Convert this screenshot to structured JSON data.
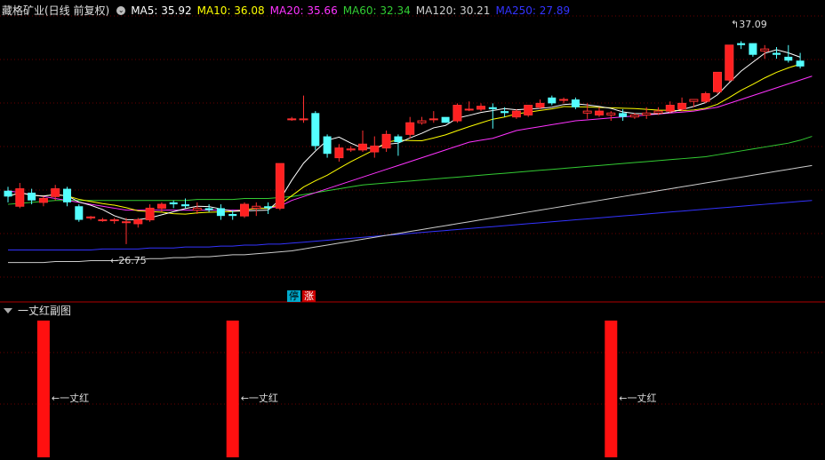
{
  "main_panel": {
    "title": "藏格矿业(日线 前复权)",
    "ma": [
      {
        "label": "MA5: 35.92",
        "color": "#ffffff"
      },
      {
        "label": "MA10: 36.08",
        "color": "#ffff00"
      },
      {
        "label": "MA20: 35.66",
        "color": "#ff33ff"
      },
      {
        "label": "MA60: 32.34",
        "color": "#33cc33"
      },
      {
        "label": "MA120: 30.21",
        "color": "#cccccc"
      },
      {
        "label": "MA250: 27.89",
        "color": "#3333ff"
      }
    ],
    "low_marker": "←26.75",
    "high_marker": "37.09",
    "limit_badges": {
      "stop": "停",
      "rise": "涨"
    }
  },
  "sub_panel": {
    "title": "一丈红副图",
    "signal_label": "←一丈红",
    "signal_count": 3
  },
  "chart_data": {
    "type": "candlestick",
    "y_range": [
      24,
      38.5
    ],
    "ohlc": [
      [
        29.5,
        29.7,
        28.9,
        29.2
      ],
      [
        28.7,
        29.9,
        28.6,
        29.6
      ],
      [
        29.4,
        29.6,
        28.8,
        29.0
      ],
      [
        28.9,
        29.2,
        28.7,
        29.1
      ],
      [
        29.2,
        29.8,
        29.0,
        29.6
      ],
      [
        29.6,
        29.7,
        28.7,
        28.9
      ],
      [
        28.7,
        28.8,
        27.9,
        28.0
      ],
      [
        28.1,
        28.2,
        28.0,
        28.15
      ],
      [
        28.0,
        28.1,
        27.9,
        28.0
      ],
      [
        28.0,
        28.1,
        27.8,
        28.0
      ],
      [
        27.9,
        28.1,
        26.75,
        27.9
      ],
      [
        27.8,
        28.1,
        27.6,
        28.0
      ],
      [
        28.0,
        28.8,
        27.9,
        28.6
      ],
      [
        28.6,
        28.9,
        28.4,
        28.8
      ],
      [
        28.9,
        29.0,
        28.6,
        28.8
      ],
      [
        28.8,
        29.1,
        28.6,
        28.7
      ],
      [
        28.5,
        28.9,
        28.3,
        28.6
      ],
      [
        28.6,
        28.8,
        28.4,
        28.5
      ],
      [
        28.6,
        28.8,
        28.0,
        28.2
      ],
      [
        28.3,
        28.5,
        28.0,
        28.2
      ],
      [
        28.2,
        28.9,
        28.1,
        28.8
      ],
      [
        28.6,
        28.9,
        28.2,
        28.7
      ],
      [
        28.7,
        28.9,
        28.3,
        28.6
      ],
      [
        28.6,
        30.9,
        28.5,
        30.9
      ],
      [
        33.2,
        33.3,
        33.1,
        33.2
      ],
      [
        33.2,
        34.4,
        33.0,
        33.2
      ],
      [
        33.5,
        33.6,
        31.6,
        31.8
      ],
      [
        32.3,
        32.4,
        31.2,
        31.4
      ],
      [
        31.2,
        31.9,
        31.0,
        31.7
      ],
      [
        31.6,
        31.8,
        31.5,
        31.65
      ],
      [
        31.6,
        32.6,
        31.5,
        31.9
      ],
      [
        31.5,
        32.3,
        31.2,
        31.8
      ],
      [
        31.7,
        32.6,
        31.5,
        32.4
      ],
      [
        32.3,
        32.4,
        31.3,
        32.0
      ],
      [
        32.4,
        33.3,
        32.2,
        33.0
      ],
      [
        33.0,
        33.3,
        32.9,
        33.1
      ],
      [
        33.2,
        33.6,
        33.0,
        33.2
      ],
      [
        33.3,
        33.2,
        33.0,
        33.0
      ],
      [
        33.1,
        34.0,
        33.0,
        33.9
      ],
      [
        33.7,
        34.1,
        33.6,
        33.7
      ],
      [
        33.7,
        34.0,
        33.6,
        33.85
      ],
      [
        33.8,
        34.0,
        32.7,
        33.7
      ],
      [
        33.6,
        33.8,
        33.3,
        33.5
      ],
      [
        33.3,
        33.7,
        33.2,
        33.6
      ],
      [
        33.4,
        33.9,
        33.3,
        33.9
      ],
      [
        33.8,
        34.2,
        33.7,
        34.0
      ],
      [
        34.3,
        34.4,
        33.9,
        34.0
      ],
      [
        34.2,
        34.3,
        34.0,
        34.2
      ],
      [
        34.2,
        34.3,
        33.7,
        33.8
      ],
      [
        33.5,
        34.0,
        33.2,
        33.6
      ],
      [
        33.4,
        33.8,
        33.3,
        33.6
      ],
      [
        33.4,
        33.6,
        33.1,
        33.5
      ],
      [
        33.5,
        33.7,
        33.1,
        33.3
      ],
      [
        33.3,
        33.5,
        33.2,
        33.4
      ],
      [
        33.4,
        33.8,
        33.2,
        33.5
      ],
      [
        33.5,
        33.8,
        33.4,
        33.6
      ],
      [
        33.6,
        34.1,
        33.5,
        33.9
      ],
      [
        33.7,
        34.3,
        33.6,
        34.0
      ],
      [
        34.1,
        34.2,
        33.8,
        34.2
      ],
      [
        34.1,
        34.6,
        34.0,
        34.5
      ],
      [
        34.6,
        35.6,
        34.5,
        35.6
      ],
      [
        35.2,
        37.0,
        35.1,
        37.0
      ],
      [
        37.1,
        37.2,
        36.8,
        37.0
      ],
      [
        37.1,
        37.09,
        36.4,
        36.5
      ],
      [
        36.7,
        37.0,
        36.3,
        36.8
      ],
      [
        36.6,
        36.9,
        36.3,
        36.5
      ],
      [
        36.4,
        37.0,
        36.1,
        36.2
      ],
      [
        36.2,
        36.6,
        35.8,
        35.9
      ]
    ],
    "ma_series": [
      {
        "name": "MA5",
        "color": "#ffffff"
      },
      {
        "name": "MA10",
        "color": "#ffff00"
      },
      {
        "name": "MA20",
        "color": "#ff33ff"
      },
      {
        "name": "MA60",
        "color": "#33cc33"
      },
      {
        "name": "MA120",
        "color": "#cccccc"
      },
      {
        "name": "MA250",
        "color": "#3333ff"
      }
    ],
    "ma20_values": [
      29.5,
      29.4,
      29.3,
      29.2,
      29.1,
      29.0,
      28.9,
      28.8,
      28.7,
      28.6,
      28.5,
      28.5,
      28.5,
      28.5,
      28.5,
      28.5,
      28.5,
      28.5,
      28.5,
      28.5,
      28.5,
      28.6,
      28.6,
      28.7,
      29.0,
      29.2,
      29.4,
      29.6,
      29.8,
      30.0,
      30.2,
      30.4,
      30.6,
      30.8,
      31.0,
      31.2,
      31.4,
      31.6,
      31.8,
      32.0,
      32.1,
      32.2,
      32.4,
      32.6,
      32.7,
      32.8,
      32.9,
      33.0,
      33.1,
      33.15,
      33.2,
      33.25,
      33.3,
      33.35,
      33.4,
      33.45,
      33.5,
      33.55,
      33.6,
      33.7,
      33.8,
      34.0,
      34.2,
      34.4,
      34.6,
      34.8,
      35.0,
      35.2,
      35.4
    ],
    "ma60_values": [
      28.8,
      28.85,
      28.9,
      28.95,
      29.0,
      29.0,
      29.0,
      29.0,
      29.0,
      29.0,
      29.0,
      29.0,
      29.0,
      29.0,
      29.0,
      29.0,
      29.05,
      29.05,
      29.05,
      29.05,
      29.1,
      29.1,
      29.1,
      29.15,
      29.2,
      29.3,
      29.4,
      29.5,
      29.6,
      29.7,
      29.8,
      29.85,
      29.9,
      29.95,
      30.0,
      30.05,
      30.1,
      30.15,
      30.2,
      30.25,
      30.3,
      30.35,
      30.4,
      30.45,
      30.5,
      30.55,
      30.6,
      30.65,
      30.7,
      30.75,
      30.8,
      30.85,
      30.9,
      30.95,
      31.0,
      31.05,
      31.1,
      31.15,
      31.2,
      31.25,
      31.35,
      31.45,
      31.55,
      31.65,
      31.75,
      31.85,
      31.95,
      32.1,
      32.3
    ],
    "ma120_values": [
      25.8,
      25.8,
      25.8,
      25.8,
      25.85,
      25.85,
      25.85,
      25.9,
      25.9,
      25.9,
      25.95,
      25.95,
      26.0,
      26.0,
      26.05,
      26.05,
      26.1,
      26.1,
      26.15,
      26.2,
      26.2,
      26.25,
      26.3,
      26.35,
      26.4,
      26.5,
      26.6,
      26.7,
      26.8,
      26.9,
      27.0,
      27.1,
      27.2,
      27.3,
      27.4,
      27.5,
      27.6,
      27.7,
      27.8,
      27.9,
      28.0,
      28.1,
      28.2,
      28.3,
      28.4,
      28.5,
      28.6,
      28.7,
      28.8,
      28.9,
      29.0,
      29.1,
      29.2,
      29.3,
      29.4,
      29.5,
      29.6,
      29.7,
      29.8,
      29.9,
      30.0,
      30.1,
      30.2,
      30.3,
      30.4,
      30.5,
      30.6,
      30.7,
      30.8
    ],
    "ma250_values": [
      26.45,
      26.45,
      26.45,
      26.45,
      26.45,
      26.45,
      26.45,
      26.45,
      26.5,
      26.5,
      26.5,
      26.5,
      26.55,
      26.55,
      26.55,
      26.6,
      26.6,
      26.6,
      26.65,
      26.65,
      26.7,
      26.7,
      26.75,
      26.75,
      26.8,
      26.85,
      26.9,
      26.95,
      27.0,
      27.05,
      27.1,
      27.15,
      27.2,
      27.25,
      27.3,
      27.35,
      27.4,
      27.45,
      27.5,
      27.55,
      27.6,
      27.65,
      27.7,
      27.75,
      27.8,
      27.85,
      27.9,
      27.95,
      28.0,
      28.05,
      28.1,
      28.15,
      28.2,
      28.25,
      28.3,
      28.35,
      28.4,
      28.45,
      28.5,
      28.55,
      28.6,
      28.65,
      28.7,
      28.75,
      28.8,
      28.85,
      28.9,
      28.95,
      29.0
    ],
    "signal_bars": [
      3,
      19,
      51
    ]
  }
}
